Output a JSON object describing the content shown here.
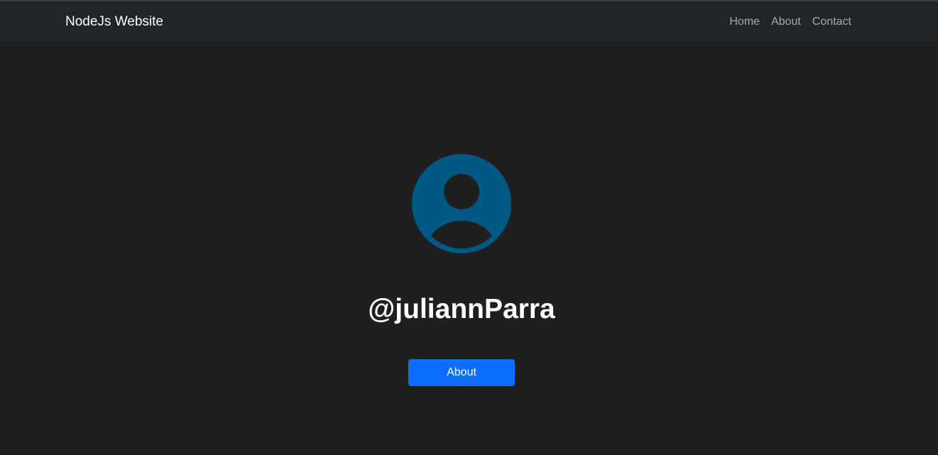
{
  "navbar": {
    "brand": "NodeJs Website",
    "links": [
      {
        "label": "Home"
      },
      {
        "label": "About"
      },
      {
        "label": "Contact"
      }
    ]
  },
  "profile": {
    "avatar_icon": "user-avatar-icon",
    "avatar_color": "#005985",
    "username": "@juliannParra",
    "button_label": "About",
    "button_color": "#0d6efd"
  },
  "colors": {
    "page_background": "#1f1f1f",
    "navbar_background": "#212529"
  }
}
